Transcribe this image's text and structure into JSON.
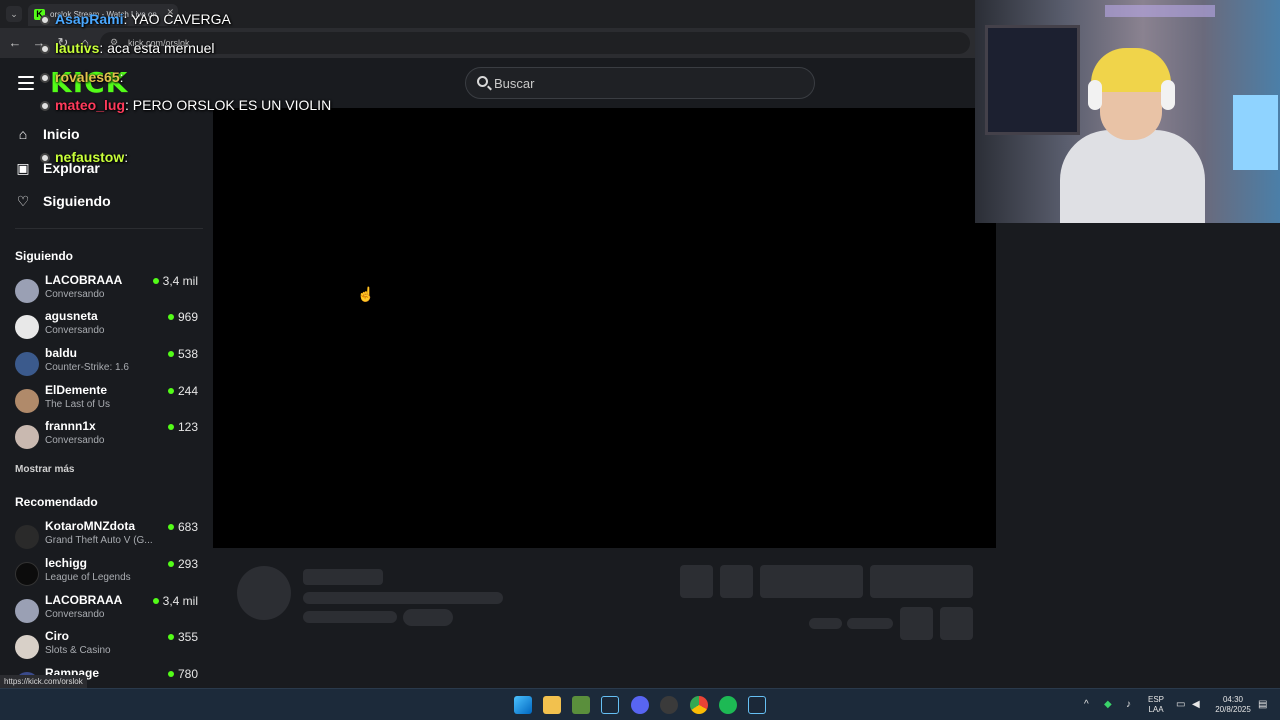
{
  "browser": {
    "tab_title": "orslok Stream - Watch Live on",
    "url": "kick.com/orslok",
    "hover_link": "https://kick.com/orslok"
  },
  "site": {
    "logo": "KICK",
    "search_placeholder": "Buscar",
    "accent_color": "#53fc18"
  },
  "nav": {
    "home": "Inicio",
    "explore": "Explorar",
    "following": "Siguiendo"
  },
  "following": {
    "title": "Siguiendo",
    "channels": [
      {
        "name": "LACOBRAAA",
        "game": "Conversando",
        "viewers": "3,4 mil"
      },
      {
        "name": "agusneta",
        "game": "Conversando",
        "viewers": "969"
      },
      {
        "name": "baldu",
        "game": "Counter-Strike: 1.6",
        "viewers": "538"
      },
      {
        "name": "ElDemente",
        "game": "The Last of Us",
        "viewers": "244"
      },
      {
        "name": "frannn1x",
        "game": "Conversando",
        "viewers": "123"
      }
    ],
    "show_more": "Mostrar más"
  },
  "recommended": {
    "title": "Recomendado",
    "channels": [
      {
        "name": "KotaroMNZdota",
        "game": "Grand Theft Auto V (G...",
        "viewers": "683"
      },
      {
        "name": "lechigg",
        "game": "League of Legends",
        "viewers": "293"
      },
      {
        "name": "LACOBRAAA",
        "game": "Conversando",
        "viewers": "3,4 mil"
      },
      {
        "name": "Ciro",
        "game": "Slots & Casino",
        "viewers": "355"
      },
      {
        "name": "Rampage",
        "game": "",
        "viewers": "780"
      }
    ]
  },
  "overlay_chat": [
    {
      "user": "AsapRami",
      "msg": ": YAO CAVERGA"
    },
    {
      "user": "lautivs",
      "msg": ": aca esta mernuel"
    },
    {
      "user": "rovales65",
      "msg": ":"
    },
    {
      "user": "mateo_lug",
      "msg": ": PERO ORSLOK ES UN VIOLIN"
    },
    {
      "user": "nefaustow",
      "msg": ":"
    }
  ],
  "taskbar": {
    "lang_line1": "ESP",
    "lang_line2": "LAA",
    "time": "04:30",
    "date": "20/8/2025"
  }
}
